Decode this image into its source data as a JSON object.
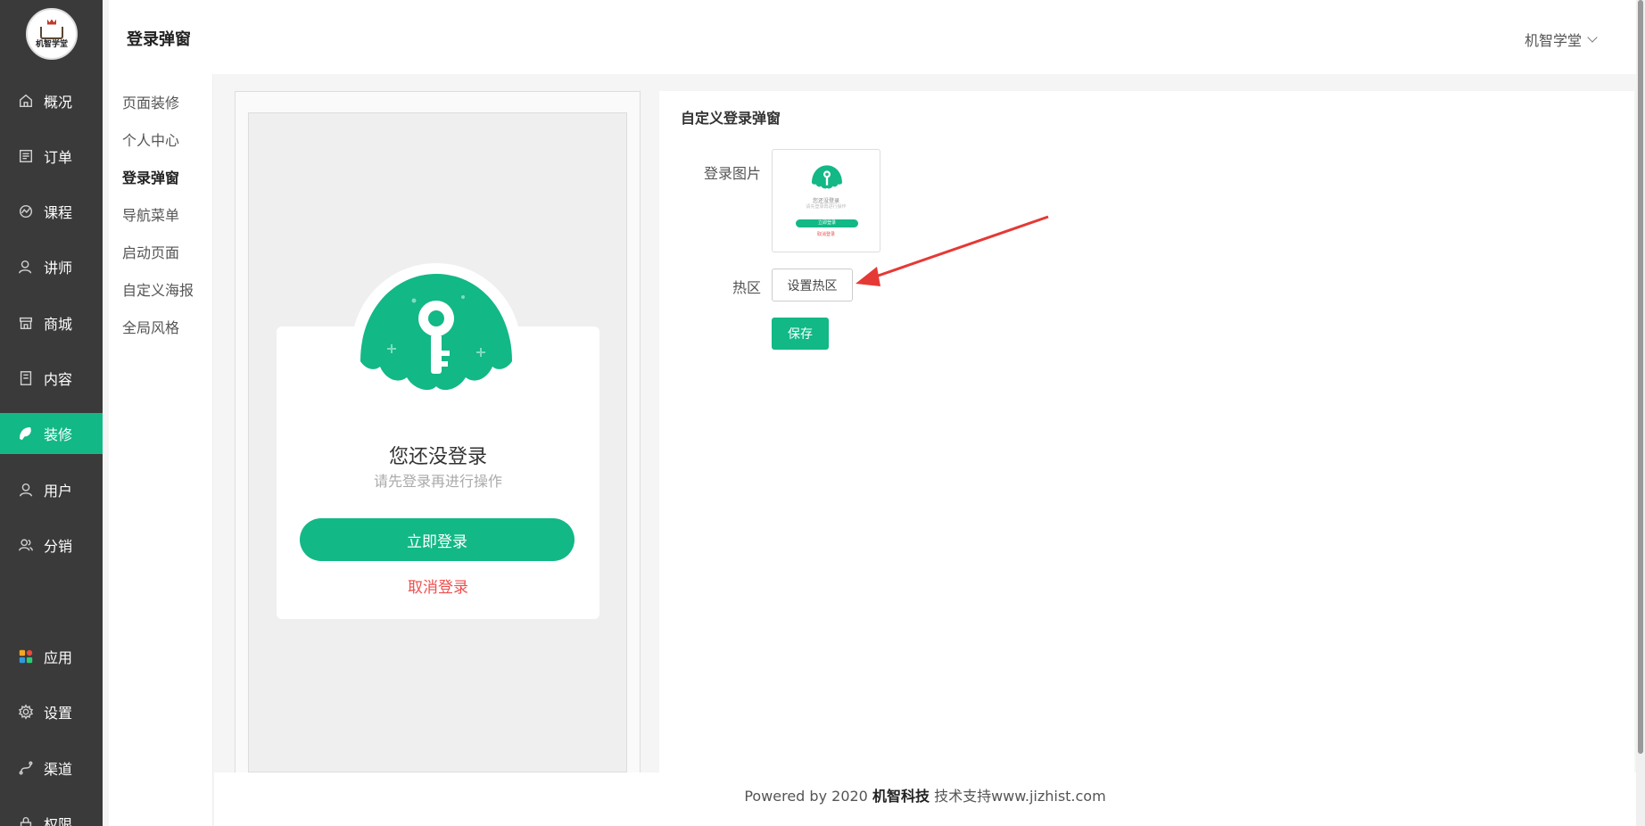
{
  "brand": {
    "logo_text": "机智学堂",
    "accent": "#12b886",
    "sidebar_bg": "#3a3a3a"
  },
  "sidebar": {
    "items": [
      {
        "label": "概况",
        "icon": "home-icon"
      },
      {
        "label": "订单",
        "icon": "order-icon"
      },
      {
        "label": "课程",
        "icon": "course-icon"
      },
      {
        "label": "讲师",
        "icon": "teacher-icon"
      },
      {
        "label": "商城",
        "icon": "store-icon"
      },
      {
        "label": "内容",
        "icon": "content-icon"
      },
      {
        "label": "装修",
        "icon": "decorate-icon"
      },
      {
        "label": "用户",
        "icon": "user-icon"
      },
      {
        "label": "分销",
        "icon": "distribution-icon"
      },
      {
        "label": "应用",
        "icon": "apps-icon"
      },
      {
        "label": "设置",
        "icon": "gear-icon"
      },
      {
        "label": "渠道",
        "icon": "channel-icon"
      },
      {
        "label": "权限",
        "icon": "permission-icon"
      }
    ],
    "active": "装修"
  },
  "header": {
    "title": "登录弹窗",
    "user_name": "机智学堂"
  },
  "submenu": {
    "items": [
      "页面装修",
      "个人中心",
      "登录弹窗",
      "导航菜单",
      "启动页面",
      "自定义海报",
      "全局风格"
    ],
    "active": "登录弹窗"
  },
  "preview": {
    "title": "您还没登录",
    "subtitle": "请先登录再进行操作",
    "login_button": "立即登录",
    "cancel_link": "取消登录"
  },
  "panel": {
    "title": "自定义登录弹窗",
    "image_label": "登录图片",
    "hotzone_label": "热区",
    "hotzone_button": "设置热区",
    "save_button": "保存"
  },
  "footer": {
    "prefix": "Powered by 2020",
    "company": "机智科技",
    "support": "技术支持www.jizhist.com"
  }
}
